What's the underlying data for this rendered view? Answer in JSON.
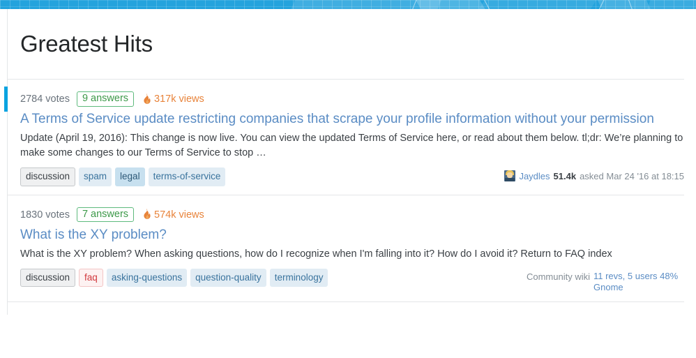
{
  "header": {
    "title": "Greatest Hits"
  },
  "theme": {
    "topbar_blue": "#24a3dd",
    "accent_bar": "#0aa3e0",
    "link_blue": "#5a8cc4",
    "answers_green": "#3d9949",
    "views_orange": "#e8833a",
    "tag_blue_bg": "#e1ecf4",
    "tag_blue_text": "#39739d"
  },
  "questions": [
    {
      "featured": true,
      "votes": "2784 votes",
      "answers": "9 answers",
      "views": "317k views",
      "flame_icon": "flame-icon",
      "title": "A Terms of Service update restricting companies that scrape your profile information without your permission",
      "excerpt": "Update (April 19, 2016): This change is now live. You can view the updated Terms of Service here, or read about them below. tl;dr: We’re planning to make some changes to our Terms of Service to stop …",
      "tags": [
        {
          "label": "discussion",
          "style": "required"
        },
        {
          "label": "spam",
          "style": "normal"
        },
        {
          "label": "legal",
          "style": "hovered"
        },
        {
          "label": "terms-of-service",
          "style": "normal"
        }
      ],
      "meta_type": "user",
      "avatar_icon": "user-avatar",
      "user": "Jaydles",
      "reputation": "51.4k",
      "asked": "asked Mar 24 '16 at 18:15"
    },
    {
      "featured": false,
      "votes": "1830 votes",
      "answers": "7 answers",
      "views": "574k views",
      "flame_icon": "flame-icon",
      "title": "What is the XY problem?",
      "excerpt": "What is the XY problem? When asking questions, how do I recognize when I'm falling into it? How do I avoid it? Return to FAQ index",
      "tags": [
        {
          "label": "discussion",
          "style": "required"
        },
        {
          "label": "faq",
          "style": "fav"
        },
        {
          "label": "asking-questions",
          "style": "normal"
        },
        {
          "label": "question-quality",
          "style": "normal"
        },
        {
          "label": "terminology",
          "style": "normal"
        }
      ],
      "meta_type": "wiki",
      "wiki_label": "Community wiki",
      "wiki_revs": "11 revs, 5 users 48% Gnome"
    }
  ]
}
